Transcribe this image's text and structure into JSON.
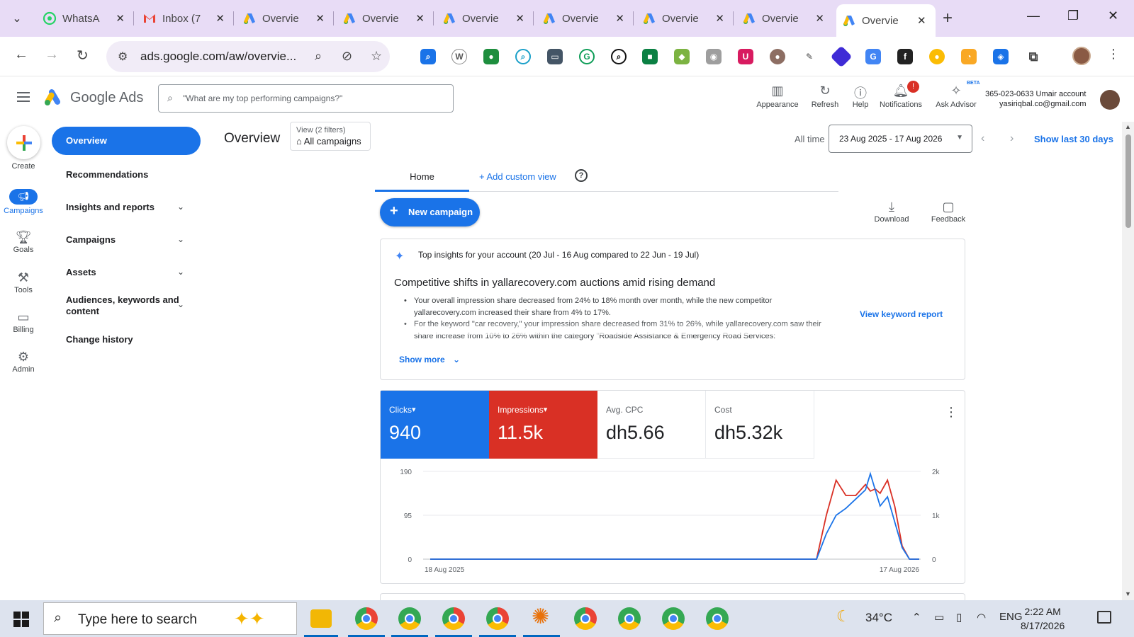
{
  "browser": {
    "tabs": [
      {
        "label": "WhatsA",
        "icon": "whatsapp-icon",
        "color": "#25d366"
      },
      {
        "label": "Inbox (7",
        "icon": "gmail-icon",
        "color": "#ea4335"
      },
      {
        "label": "Overvie",
        "icon": "google-ads-icon",
        "color": "#4285f4"
      },
      {
        "label": "Overvie",
        "icon": "google-ads-icon",
        "color": "#4285f4"
      },
      {
        "label": "Overvie",
        "icon": "google-ads-icon",
        "color": "#4285f4"
      },
      {
        "label": "Overvie",
        "icon": "google-ads-icon",
        "color": "#4285f4"
      },
      {
        "label": "Overvie",
        "icon": "google-ads-icon",
        "color": "#4285f4"
      },
      {
        "label": "Overvie",
        "icon": "google-ads-icon",
        "color": "#4285f4"
      },
      {
        "label": "Overvie",
        "icon": "google-ads-icon",
        "color": "#4285f4",
        "active": true
      }
    ],
    "url": "ads.google.com/aw/overvie..."
  },
  "header": {
    "product": "Google Ads",
    "search_placeholder": "\"What are my top performing campaigns?\"",
    "tools": {
      "appearance": "Appearance",
      "refresh": "Refresh",
      "help": "Help",
      "notifications": "Notifications",
      "notifications_count": "!",
      "ask_advisor": "Ask Advisor",
      "beta": "BETA"
    },
    "account_line1": "365-023-0633 Umair account",
    "account_line2": "yasiriqbal.co@gmail.com"
  },
  "rail": {
    "create": "Create",
    "campaigns": "Campaigns",
    "goals": "Goals",
    "tools": "Tools",
    "billing": "Billing",
    "admin": "Admin"
  },
  "nav": {
    "overview": "Overview",
    "recommendations": "Recommendations",
    "insights": "Insights and reports",
    "campaigns": "Campaigns",
    "assets": "Assets",
    "audiences_l1": "Audiences, keywords and",
    "audiences_l2": "content",
    "change_history": "Change history"
  },
  "page": {
    "title": "Overview",
    "view_filters": "View (2 filters)",
    "view_name": "All campaigns",
    "all_time": "All time",
    "date_range": "23 Aug 2025 - 17 Aug 2026",
    "show_last": "Show last 30 days",
    "tab_home": "Home",
    "add_custom_view": "Add custom view",
    "new_campaign": "New campaign",
    "download": "Download",
    "feedback": "Feedback"
  },
  "insights": {
    "header": "Top insights for your account (20 Jul - 16 Aug compared to 22 Jun - 19 Jul)",
    "title": "Competitive shifts in yallarecovery.com auctions amid rising demand",
    "bullet1": "Your overall impression share decreased from 24% to 18% month over month, while the new competitor yallarecovery.com increased their share from 4% to 17%.",
    "bullet2": "For the keyword \"car recovery,\" your impression share decreased from 31% to 26%, while yallarecovery.com saw their share increase from 10% to 26% within the category \"Roadside Assistance & Emergency Road Services:",
    "link": "View keyword report",
    "show_more": "Show more"
  },
  "metrics": [
    {
      "name": "Clicks",
      "value": "940",
      "style": "blue"
    },
    {
      "name": "Impressions",
      "value": "11.5k",
      "style": "red"
    },
    {
      "name": "Avg. CPC",
      "value": "dh5.66",
      "style": "plain"
    },
    {
      "name": "Cost",
      "value": "dh5.32k",
      "style": "plain"
    }
  ],
  "chart_data": {
    "type": "line",
    "x_labels": [
      "18 Aug 2025",
      "17 Aug 2026"
    ],
    "left_ticks": [
      "190",
      "95",
      "0"
    ],
    "right_ticks": [
      "2k",
      "1k",
      "0"
    ],
    "left_ylim": [
      0,
      190
    ],
    "right_ylim": [
      0,
      2000
    ],
    "grid": true,
    "series": [
      {
        "name": "Clicks",
        "axis": "left",
        "color": "#1a73e8",
        "values": [
          0,
          0,
          0,
          0,
          0,
          0,
          0,
          0,
          0,
          0,
          0,
          0,
          0,
          0,
          0,
          0,
          0,
          0,
          0,
          0,
          0,
          0,
          0,
          0,
          0,
          0,
          0,
          0,
          0,
          0,
          0,
          0,
          0,
          0,
          0,
          0,
          0,
          0,
          0,
          0,
          0,
          0,
          0,
          0,
          0,
          0,
          0,
          0,
          0,
          0,
          0,
          0,
          0,
          0,
          0,
          0,
          0,
          0,
          0,
          0,
          0,
          0,
          0,
          0,
          0,
          0,
          0,
          0,
          0,
          0,
          0,
          0,
          0,
          0,
          0,
          0,
          0,
          0,
          0,
          0,
          0,
          0,
          0,
          0,
          0,
          0,
          0,
          0,
          0,
          0,
          0,
          0,
          0,
          0,
          0,
          0,
          0,
          0,
          0,
          0,
          0,
          0,
          0,
          0,
          0,
          0,
          0,
          0,
          0,
          0,
          0,
          0,
          0,
          0,
          0,
          0,
          0,
          0,
          0,
          0,
          0,
          0,
          0,
          0,
          0,
          0,
          0,
          0,
          0,
          0,
          0,
          0,
          0,
          0,
          0,
          0,
          0,
          0,
          0,
          0,
          0,
          0,
          0,
          0,
          0,
          0,
          0,
          0,
          0,
          0,
          0,
          0,
          0,
          0,
          0,
          0,
          0,
          0,
          0,
          0,
          0,
          0,
          0,
          0,
          0,
          0,
          0,
          0,
          0,
          0,
          0,
          0,
          0,
          0,
          0,
          0,
          0,
          0,
          0,
          0,
          0,
          0,
          0,
          0,
          0,
          0,
          0,
          0,
          0,
          0,
          0,
          0,
          0,
          0,
          0,
          0,
          0,
          0,
          0,
          0,
          0,
          0,
          0,
          0,
          0,
          0,
          0,
          0,
          0,
          0,
          0,
          0,
          0,
          0,
          0,
          0,
          0,
          0,
          0,
          0,
          0,
          0,
          0,
          0,
          0,
          0,
          0,
          0,
          0,
          0,
          0,
          0,
          0,
          0,
          0,
          0,
          0,
          0,
          0,
          0,
          0,
          0,
          0,
          0,
          0,
          0,
          0,
          0,
          0,
          0,
          0,
          0,
          0,
          0,
          0,
          0,
          0,
          0,
          0,
          0,
          0,
          0,
          0,
          0,
          0,
          0,
          0,
          0,
          0,
          0,
          0,
          0,
          0,
          0,
          0,
          0,
          0,
          0,
          0,
          0,
          0,
          0,
          0,
          0,
          0,
          0,
          0,
          0,
          0,
          0,
          0,
          0,
          0,
          0,
          0,
          0,
          0,
          0,
          0,
          0,
          0,
          0,
          0,
          0,
          0,
          0,
          0,
          0,
          0,
          0,
          0,
          0,
          0,
          0,
          0,
          0,
          0,
          0,
          0,
          0,
          0,
          0,
          0,
          0,
          0,
          0,
          0,
          0,
          0,
          0,
          0,
          0,
          0,
          0,
          0,
          0,
          0,
          0,
          0,
          0,
          0,
          0,
          0,
          0,
          0,
          0,
          0,
          0,
          0,
          0,
          0,
          0,
          0,
          0,
          0,
          0,
          0,
          0,
          0,
          0,
          0,
          0,
          0,
          0,
          0,
          0,
          0,
          0,
          0,
          0,
          0,
          0,
          0,
          0,
          0,
          0,
          0,
          0,
          0,
          0,
          0,
          0,
          0,
          0,
          0,
          0,
          0,
          0,
          0,
          0,
          0,
          0,
          0,
          0,
          0,
          0,
          0,
          0,
          0,
          0,
          0,
          0,
          0,
          0,
          0,
          0,
          0,
          0,
          0,
          0,
          0,
          0,
          0,
          0,
          0,
          0,
          0,
          0,
          0,
          0,
          0,
          0,
          0,
          0,
          0,
          0,
          0,
          0,
          0,
          0,
          0,
          0,
          0,
          0,
          0,
          0,
          0,
          0,
          0,
          0
        ]
      },
      {
        "name": "Impressions",
        "axis": "right",
        "color": "#d93025",
        "values": []
      }
    ],
    "peaks": {
      "x_frac": [
        0,
        0.79,
        0.81,
        0.83,
        0.85,
        0.87,
        0.89,
        0.9,
        0.91,
        0.92,
        0.935,
        0.95,
        0.965,
        0.98,
        1.0
      ],
      "clicks": [
        0,
        0,
        55,
        95,
        110,
        130,
        150,
        185,
        150,
        115,
        135,
        80,
        25,
        0,
        0
      ],
      "impressions": [
        0,
        0,
        1000,
        1800,
        1450,
        1450,
        1700,
        1550,
        1600,
        1500,
        1800,
        1200,
        300,
        0,
        0
      ]
    }
  },
  "taskbar": {
    "search_placeholder": "Type here to search",
    "temperature": "34°C",
    "language": "ENG",
    "time": "2:22 AM",
    "date": "8/17/2026"
  }
}
